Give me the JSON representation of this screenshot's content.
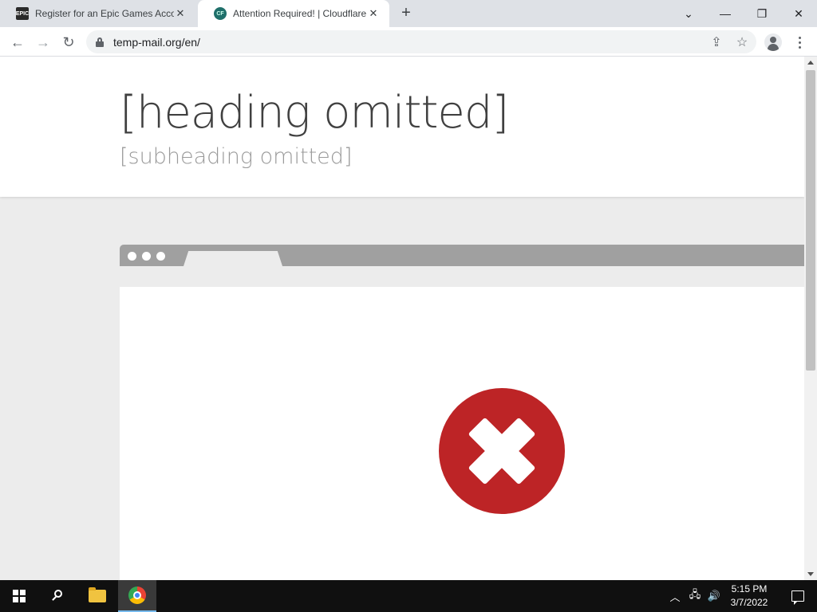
{
  "browser": {
    "tabs": [
      {
        "title": "Register for an Epic Games Accou",
        "favicon": "epic-games-favicon",
        "active": false,
        "close_label": "✕"
      },
      {
        "title": "Attention Required! | Cloudflare",
        "favicon": "cloudflare-favicon",
        "active": true,
        "close_label": "✕"
      }
    ],
    "new_tab_label": "+",
    "window_controls": {
      "tab_search": "⌄",
      "minimize": "—",
      "restore": "❐",
      "close": "✕"
    },
    "address_bar": {
      "url": "temp-mail.org/en/",
      "secure": true
    },
    "nav": {
      "back": "←",
      "forward": "→",
      "reload": "↻"
    },
    "toolbar_icons": [
      "share-icon",
      "bookmark-star-icon",
      "profile-avatar-icon",
      "menu-kebab-icon"
    ]
  },
  "page": {
    "headline": "[heading omitted]",
    "subheading": "[subheading omitted]",
    "error_icon": "red-x-circle-icon",
    "colors": {
      "error_red": "#bd2426",
      "headline_gray": "#404040",
      "subhead_gray": "#9a9a9a",
      "background": "#ececec"
    }
  },
  "taskbar": {
    "time": "5:15 PM",
    "date": "3/7/2022",
    "pinned": [
      "windows-start-icon",
      "search-icon",
      "file-explorer-icon",
      "chrome-icon"
    ],
    "tray": {
      "chevron": "︿",
      "network": "🖧",
      "volume": "🔊"
    }
  }
}
